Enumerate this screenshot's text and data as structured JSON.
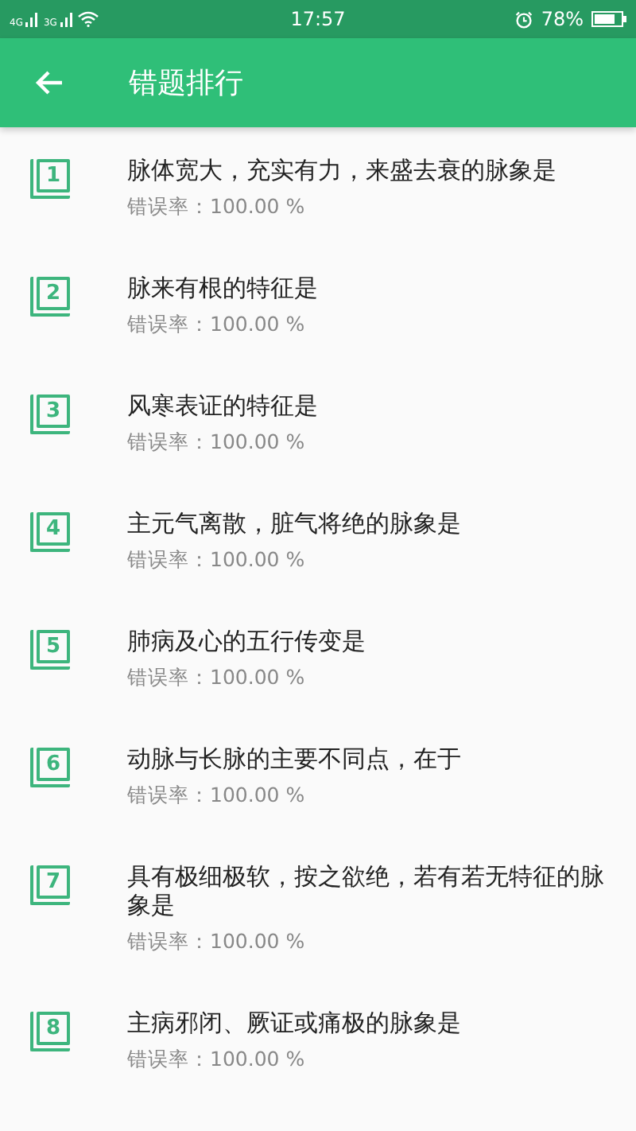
{
  "status_bar": {
    "network_1": "4G",
    "network_2": "3G",
    "time": "17:57",
    "battery": "78%"
  },
  "app_bar": {
    "title": "错题排行"
  },
  "items": [
    {
      "rank": "1",
      "title": "脉体宽大，充实有力，来盛去衰的脉象是",
      "error_rate": "错误率：100.00 %"
    },
    {
      "rank": "2",
      "title": "脉来有根的特征是",
      "error_rate": "错误率：100.00 %"
    },
    {
      "rank": "3",
      "title": "风寒表证的特征是",
      "error_rate": "错误率：100.00 %"
    },
    {
      "rank": "4",
      "title": "主元气离散，脏气将绝的脉象是",
      "error_rate": "错误率：100.00 %"
    },
    {
      "rank": "5",
      "title": "肺病及心的五行传变是",
      "error_rate": "错误率：100.00 %"
    },
    {
      "rank": "6",
      "title": "动脉与长脉的主要不同点，在于",
      "error_rate": "错误率：100.00 %"
    },
    {
      "rank": "7",
      "title": "具有极细极软，按之欲绝，若有若无特征的脉象是",
      "error_rate": "错误率：100.00 %"
    },
    {
      "rank": "8",
      "title": "主病邪闭、厥证或痛极的脉象是",
      "error_rate": "错误率：100.00 %"
    }
  ]
}
